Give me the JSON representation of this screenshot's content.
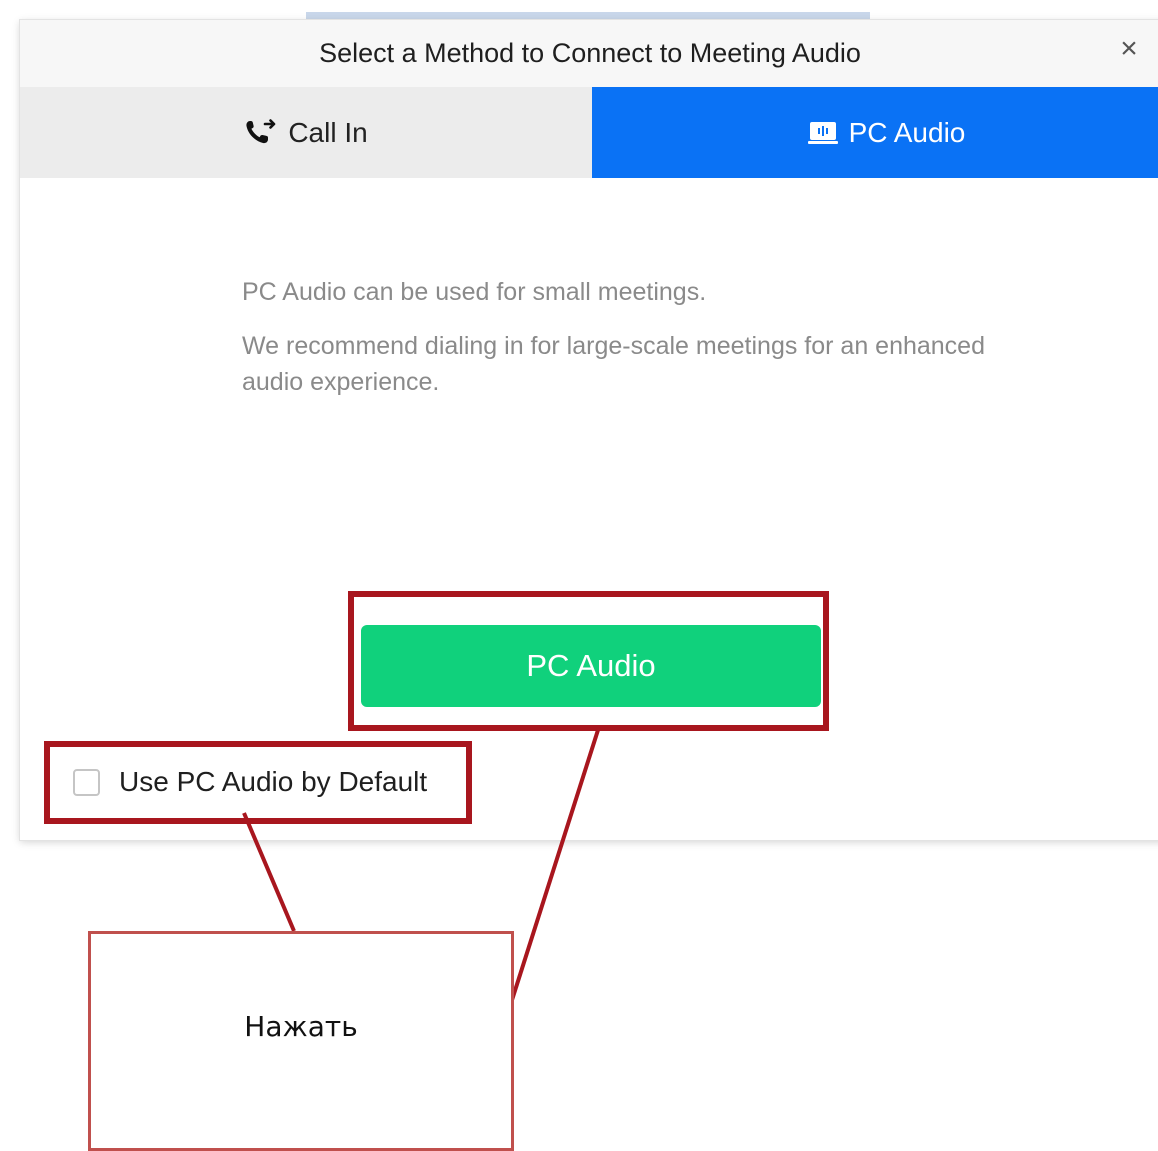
{
  "dialog": {
    "title": "Select a Method to Connect to Meeting Audio",
    "close_icon": "close-icon",
    "close_label": "×"
  },
  "tabs": [
    {
      "label": "Call In",
      "icon": "phone-icon",
      "selected": false
    },
    {
      "label": "PC Audio",
      "icon": "pc-audio-icon",
      "selected": true
    }
  ],
  "content": {
    "line1": "PC Audio can be used for small meetings.",
    "line2": "We recommend dialing in for large-scale meetings for an enhanced audio experience."
  },
  "primary_button": {
    "label": "PC Audio"
  },
  "default_checkbox": {
    "label": "Use PC Audio by Default",
    "checked": false
  },
  "annotation": {
    "callout_text": "Нажать",
    "highlight_color": "#a8161e",
    "callout_border_color": "#c0504d"
  },
  "colors": {
    "accent_tab": "#0a72f5",
    "primary_button": "#10d17c",
    "inactive_tab": "#ececec"
  }
}
